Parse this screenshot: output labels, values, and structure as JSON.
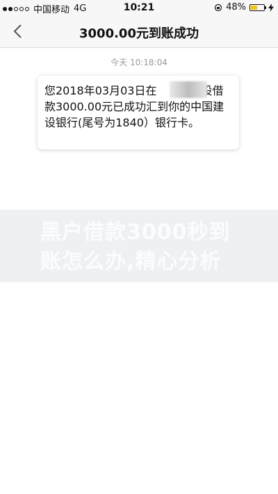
{
  "status_bar": {
    "carrier": "中国移动",
    "network": "4G",
    "time": "10:21",
    "battery_percent": "48%",
    "battery_level": 0.48,
    "battery_color": "#f1c40f"
  },
  "nav": {
    "back_icon": "chevron-left-icon",
    "title": "3000.00元到账成功"
  },
  "chat": {
    "timestamp": "今天 10:18:04",
    "message": "您2018年03月03日在　　　　设借款3000.00元已成功汇到你的中国建设银行(尾号为1840）银行卡。"
  },
  "watermark": {
    "text": "黑户借款3000秒到账怎么办,精心分析"
  }
}
